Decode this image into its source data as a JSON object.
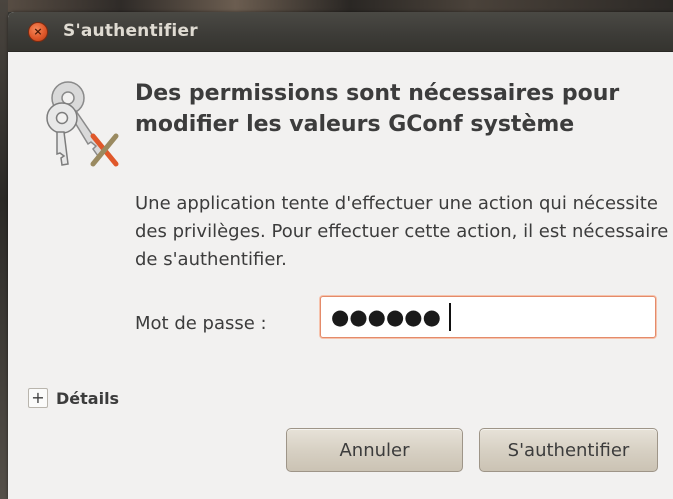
{
  "window": {
    "title": "S'authentifier",
    "close_symbol": "×"
  },
  "icon": "keys-icon",
  "heading": "Des permissions sont nécessaires pour modifier les valeurs GConf système",
  "message": "Une application tente d'effectuer une action qui nécessite des privilèges. Pour effectuer cette action, il est nécessaire de s'authentifier.",
  "password": {
    "label": "Mot de passe :",
    "value": "●●●●●●"
  },
  "details": {
    "toggle_symbol": "+",
    "label": "Détails"
  },
  "buttons": {
    "cancel": "Annuler",
    "authenticate": "S'authentifier"
  },
  "colors": {
    "titlebar": "#3c3b37",
    "close_button": "#e0582a",
    "dialog_bg": "#f2f1f0",
    "input_focus": "#e48b6a"
  }
}
